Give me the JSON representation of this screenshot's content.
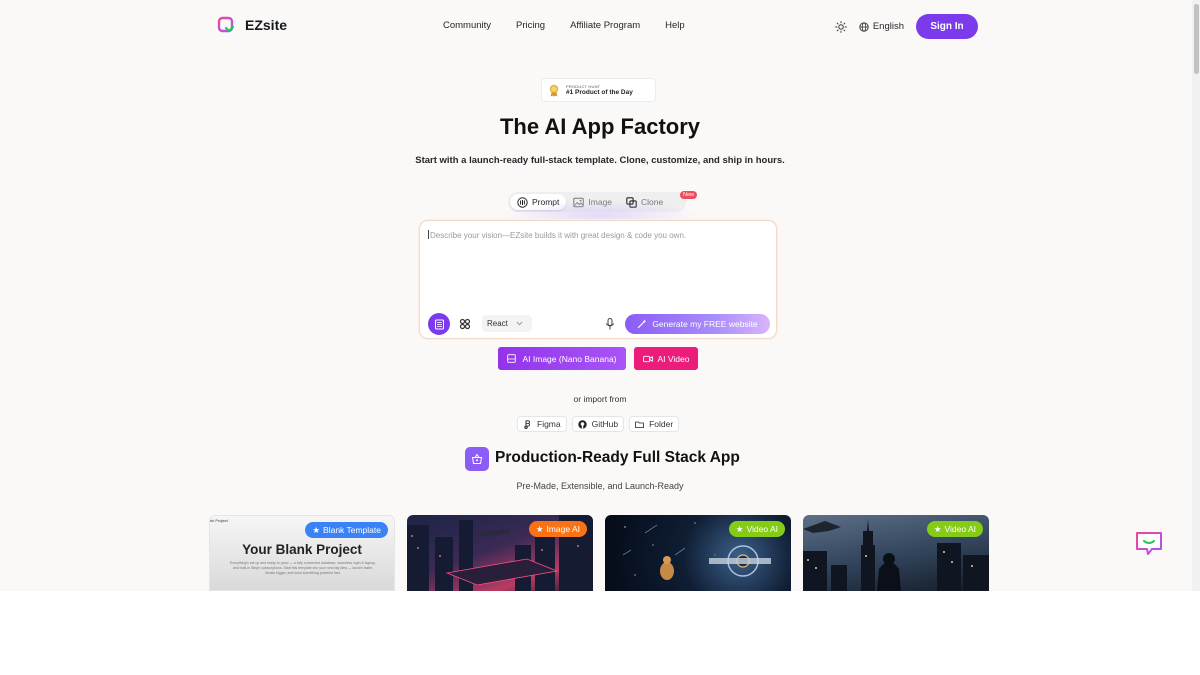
{
  "header": {
    "brand": "EZsite",
    "nav": [
      "Community",
      "Pricing",
      "Affiliate Program",
      "Help"
    ],
    "language": "English",
    "signin_label": "Sign In"
  },
  "hero": {
    "badge_small": "PRODUCT HUNT",
    "badge_big": "#1 Product of the Day",
    "title": "The AI App Factory",
    "subtitle": "Start with a launch-ready full-stack template. Clone, customize, and ship in hours."
  },
  "tabs": [
    {
      "label": "Prompt",
      "icon": "prompt-icon",
      "active": true
    },
    {
      "label": "Image",
      "icon": "image-icon",
      "active": false
    },
    {
      "label": "Clone",
      "icon": "clone-icon",
      "active": false
    }
  ],
  "new_badge": "New",
  "prompt": {
    "placeholder": "Describe your vision—EZsite builds it with great design & code you own.",
    "framework": "React",
    "generate_label": "Generate my FREE website"
  },
  "ai_buttons": {
    "image_label": "AI Image (Nano Banana)",
    "video_label": "AI Video"
  },
  "import": {
    "label": "or import from",
    "sources": [
      "Figma",
      "GitHub",
      "Folder"
    ]
  },
  "section": {
    "title": "Production-Ready Full Stack App",
    "subtitle": "Pre-Made, Extensible, and Launch-Ready"
  },
  "cards": [
    {
      "tag": "Blank Template",
      "tag_color": "#3b82f6",
      "title": "Your Blank Project",
      "mini": "nk Project",
      "text": "Everything's set up and ready to grow — a fully connected database, seamless login & signup, and built-in Stripe subscriptions. Start this template into your next big idea — launch faster, iterate bigger, and build something powerful fast."
    },
    {
      "tag": "Image AI",
      "tag_color": "#f97316"
    },
    {
      "tag": "Video AI",
      "tag_color": "#84cc16"
    },
    {
      "tag": "Video AI",
      "tag_color": "#84cc16"
    }
  ],
  "colors": {
    "accent": "#7c3aed",
    "pink": "#ec1c7a"
  }
}
